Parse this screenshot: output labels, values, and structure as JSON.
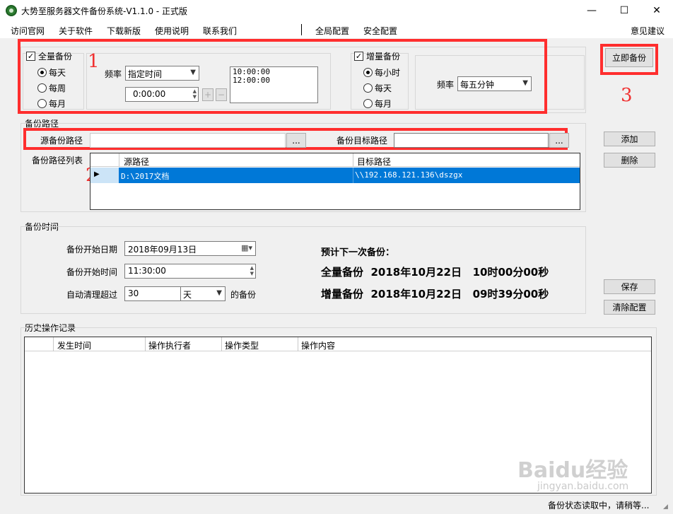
{
  "window": {
    "title": "大势至服务器文件备份系统-V1.1.0 - 正式版",
    "minimize_glyph": "—",
    "maximize_glyph": "☐",
    "close_glyph": "✕"
  },
  "menu": {
    "items": [
      "访问官网",
      "关于软件",
      "下载新版",
      "使用说明",
      "联系我们",
      "全局配置",
      "安全配置"
    ],
    "feedback": "意见建议"
  },
  "full_backup": {
    "label": "全量备份",
    "checked": true,
    "options": [
      "每天",
      "每周",
      "每月"
    ],
    "selected": "每天",
    "freq_label": "频率",
    "freq_value": "指定时间",
    "time_value": "0:00:00",
    "add_label": "+",
    "remove_label": "−",
    "times": [
      "10:00:00",
      "12:00:00"
    ]
  },
  "incremental_backup": {
    "label": "增量备份",
    "checked": true,
    "options": [
      "每小时",
      "每天",
      "每月"
    ],
    "selected": "每小时",
    "freq_label": "频率",
    "freq_value": "每五分钟"
  },
  "backup_now_label": "立即备份",
  "annotations": [
    "1",
    "2",
    "3"
  ],
  "backup_path": {
    "section_title": "备份路径",
    "source_label": "源备份路径",
    "source_value": "",
    "browse_label": "...",
    "target_label": "备份目标路径",
    "target_value": "",
    "add_label": "添加",
    "delete_label": "删除",
    "list_label": "备份路径列表",
    "columns": [
      "源路径",
      "目标路径"
    ],
    "rows": [
      {
        "source": "D:\\2017文档",
        "target": "\\\\192.168.121.136\\dszgx"
      }
    ]
  },
  "backup_time": {
    "section_title": "备份时间",
    "start_date_label": "备份开始日期",
    "start_date": "2018年09月13日",
    "start_time_label": "备份开始时间",
    "start_time": "11:30:00",
    "auto_clean_label": "自动清理超过",
    "auto_clean_value": "30",
    "auto_clean_unit": "天",
    "auto_clean_suffix": "的备份",
    "next_title": "预计下一次备份：",
    "next_full": "全量备份  2018年10月22日   10时00分00秒",
    "next_incr": "增量备份  2018年10月22日   09时39分00秒",
    "save_label": "保存",
    "clear_label": "清除配置"
  },
  "history": {
    "section_title": "历史操作记录",
    "columns": [
      "发生时间",
      "操作执行者",
      "操作类型",
      "操作内容"
    ]
  },
  "status_text": "备份状态读取中，请稍等...",
  "watermark": {
    "brand": "Baidu经验",
    "url": "jingyan.baidu.com"
  },
  "colors": {
    "annotation_red": "#ff2e2e",
    "selection_blue": "#0078d7"
  }
}
